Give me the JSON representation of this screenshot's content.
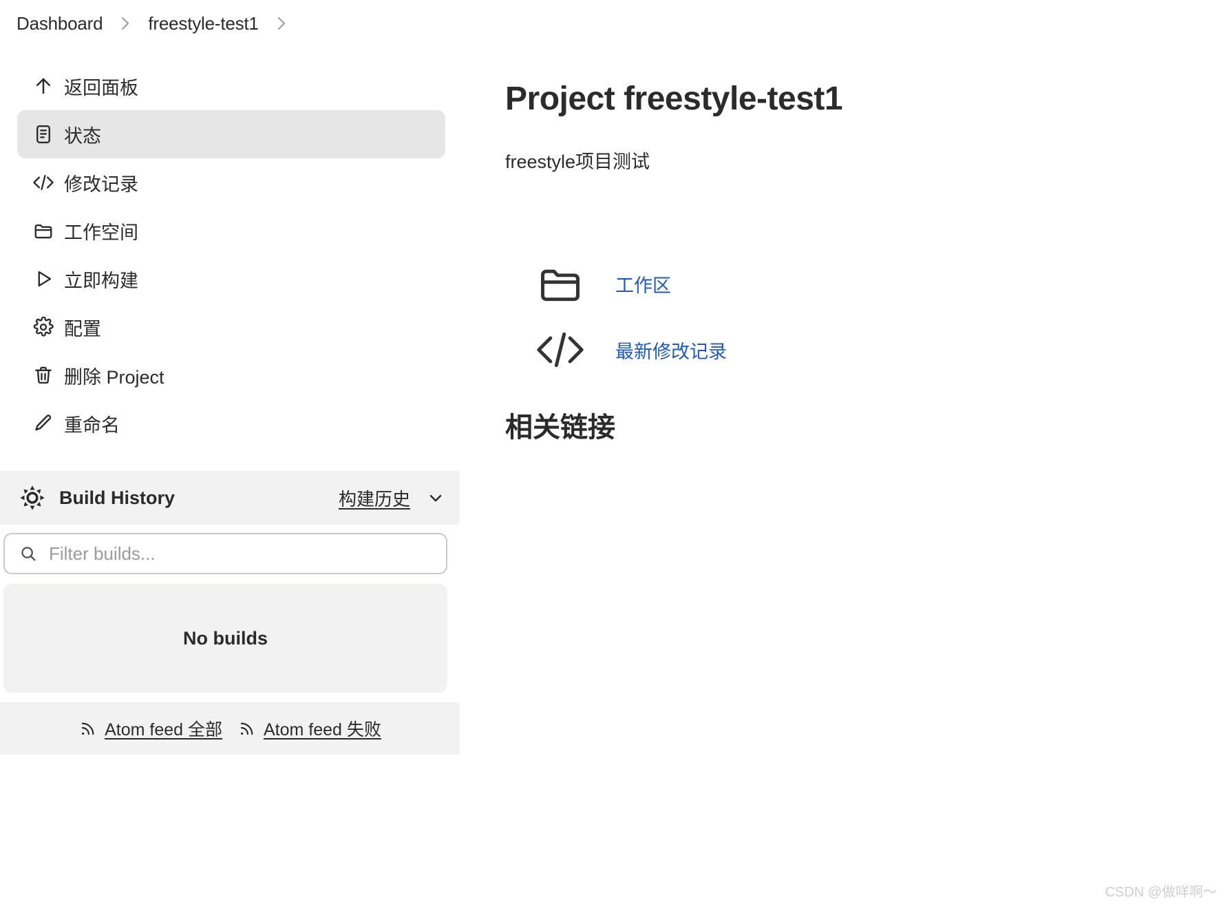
{
  "breadcrumb": {
    "items": [
      {
        "label": "Dashboard"
      },
      {
        "label": "freestyle-test1"
      }
    ],
    "separator": "›"
  },
  "sidebar": {
    "items": [
      {
        "label": "返回面板",
        "icon": "arrow-up-icon",
        "active": false
      },
      {
        "label": "状态",
        "icon": "document-icon",
        "active": true
      },
      {
        "label": "修改记录",
        "icon": "code-icon",
        "active": false
      },
      {
        "label": "工作空间",
        "icon": "folder-icon",
        "active": false
      },
      {
        "label": "立即构建",
        "icon": "play-icon",
        "active": false
      },
      {
        "label": "配置",
        "icon": "gear-icon",
        "active": false
      },
      {
        "label": "删除 Project",
        "icon": "trash-icon",
        "active": false
      },
      {
        "label": "重命名",
        "icon": "pencil-icon",
        "active": false
      }
    ]
  },
  "build_history": {
    "icon": "build-history-icon",
    "title": "Build History",
    "link_label": "构建历史",
    "chevron": "chevron-down-icon",
    "filter": {
      "placeholder": "Filter builds...",
      "value": "",
      "icon": "search-icon"
    },
    "empty_label": "No builds",
    "feeds": [
      {
        "label": "Atom feed 全部",
        "icon": "rss-icon"
      },
      {
        "label": "Atom feed 失败",
        "icon": "rss-icon"
      }
    ]
  },
  "main": {
    "title": "Project freestyle-test1",
    "description": "freestyle项目测试",
    "links": [
      {
        "label": "工作区",
        "icon": "folder-icon"
      },
      {
        "label": "最新修改记录",
        "icon": "code-icon"
      }
    ],
    "related_heading": "相关链接"
  },
  "watermark": "CSDN @做咩啊～",
  "colors": {
    "link": "#1f5bbf",
    "active_nav_bg": "#e6e6e6",
    "panel_bg": "#f2f2f2",
    "text": "#2b2b2b",
    "input_border": "#c3cbd1"
  }
}
